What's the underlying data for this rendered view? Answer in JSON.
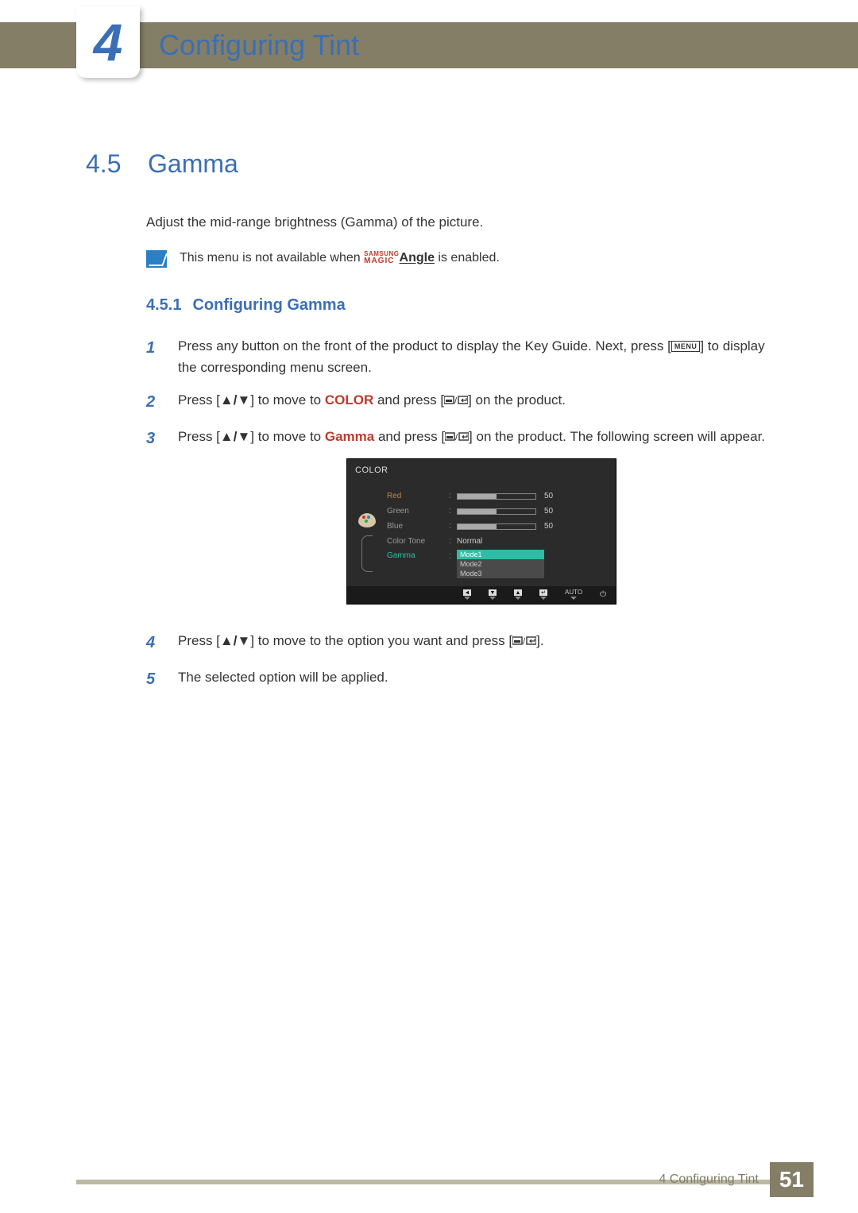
{
  "chapter": {
    "number": "4",
    "title": "Configuring Tint"
  },
  "section": {
    "number": "4.5",
    "title": "Gamma"
  },
  "intro": "Adjust the mid-range brightness (Gamma) of the picture.",
  "note": {
    "pre": "This menu is not available when ",
    "samsung": "SAMSUNG",
    "magic": "MAGIC",
    "angle": "Angle",
    "post": " is enabled."
  },
  "subsection": {
    "number": "4.5.1",
    "title": "Configuring Gamma"
  },
  "steps": {
    "s1": {
      "num": "1",
      "a": "Press any button on the front of the product to display the Key Guide. Next, press [",
      "menu": "MENU",
      "b": "] to display the corresponding menu screen."
    },
    "s2": {
      "num": "2",
      "a": "Press [",
      "b": "] to move to ",
      "kw": "COLOR",
      "c": " and press [",
      "d": "] on the product."
    },
    "s3": {
      "num": "3",
      "a": "Press [",
      "b": "] to move to ",
      "kw": "Gamma",
      "c": " and press [",
      "d": "] on the product. The following screen will appear."
    },
    "s4": {
      "num": "4",
      "a": "Press [",
      "b": "] to move to the option you want and press [",
      "c": "]."
    },
    "s5": {
      "num": "5",
      "a": "The selected option will be applied."
    }
  },
  "osd": {
    "title": "COLOR",
    "rows": {
      "red": {
        "label": "Red",
        "value": "50"
      },
      "green": {
        "label": "Green",
        "value": "50"
      },
      "blue": {
        "label": "Blue",
        "value": "50"
      },
      "tone": {
        "label": "Color Tone",
        "value": "Normal"
      },
      "gamma": {
        "label": "Gamma"
      }
    },
    "modes": {
      "m1": "Mode1",
      "m2": "Mode2",
      "m3": "Mode3"
    },
    "footer": {
      "auto": "AUTO"
    }
  },
  "footer": {
    "chapter_ref": "4 Configuring Tint",
    "page": "51"
  },
  "glyphs": {
    "up": "▲",
    "down": "▼",
    "left": "◄",
    "enter": "↵",
    "power": "⏻"
  }
}
